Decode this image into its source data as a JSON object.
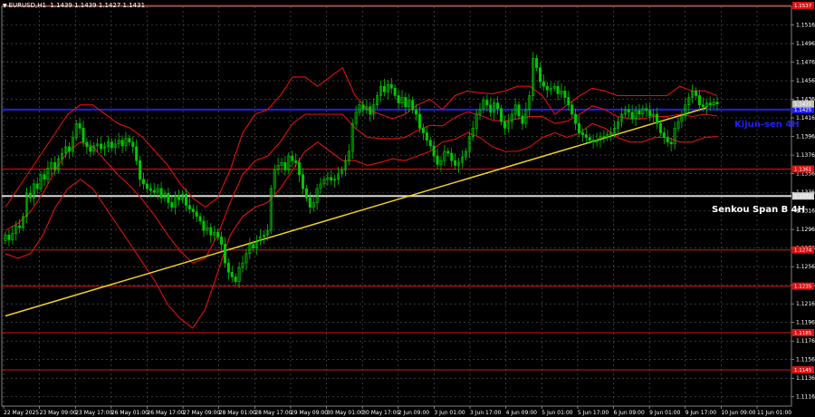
{
  "header": {
    "symbol": "EURUSD,H1",
    "ohlc": "1.1439 1.1439 1.1427 1.1431"
  },
  "colors": {
    "background": "#000000",
    "grid": "#5a5a5a",
    "candle": "#00c800",
    "bands": "#e01010",
    "trendline": "#f0d020",
    "kijun": "#1e1eff",
    "senkou": "#d8d8d8",
    "level": "#e01010"
  },
  "chart_data": {
    "type": "candlestick",
    "title": "",
    "ylim": [
      1.1106,
      1.1536
    ],
    "y_ticks": [
      "1.1516",
      "1.1496",
      "1.1476",
      "1.1456",
      "1.1436",
      "1.1416",
      "1.1396",
      "1.1376",
      "1.1356",
      "1.1336",
      "1.1316",
      "1.1296",
      "1.1276",
      "1.1256",
      "1.1236",
      "1.1216",
      "1.1196",
      "1.1176",
      "1.1156",
      "1.1136",
      "1.1116"
    ],
    "x_ticks": [
      "22 May 2025",
      "23 May 09:00",
      "23 May 17:00",
      "26 May 01:00",
      "26 May 17:00",
      "27 May 09:00",
      "28 May 01:00",
      "28 May 17:00",
      "29 May 09:00",
      "30 May 01:00",
      "30 May 17:00",
      "2 Jun 09:00",
      "3 Jun 01:00",
      "3 Jun 17:00",
      "4 Jun 09:00",
      "5 Jun 01:00",
      "5 Jun 17:00",
      "6 Jun 09:00",
      "9 Jun 01:00",
      "9 Jun 17:00",
      "10 Jun 09:00",
      "11 Jun 01:00"
    ],
    "current_price": "1.1431",
    "kijun": {
      "name": "Kijun-sen 4H",
      "value": 1.1425,
      "price_tag": "1.1425"
    },
    "senkou_b": {
      "name": "Senkou Span B 4H",
      "value": 1.1332,
      "price_tag": "1.1332"
    },
    "levels": [
      {
        "value": 1.1537,
        "tag": "1.1537"
      },
      {
        "value": 1.1361,
        "tag": "1.1361"
      },
      {
        "value": 1.1274,
        "tag": "1.1274"
      },
      {
        "value": 1.1235,
        "tag": "1.1235"
      },
      {
        "value": 1.1185,
        "tag": "1.1185"
      },
      {
        "value": 1.1145,
        "tag": "1.1145"
      }
    ],
    "trendline": {
      "from": [
        0,
        1.1203
      ],
      "to": [
        198,
        1.1427
      ]
    },
    "close": [
      1.129,
      1.1285,
      1.1292,
      1.13,
      1.1298,
      1.131,
      1.1335,
      1.133,
      1.1345,
      1.134,
      1.1355,
      1.135,
      1.1362,
      1.1368,
      1.136,
      1.1372,
      1.1378,
      1.1385,
      1.138,
      1.1395,
      1.141,
      1.1405,
      1.139,
      1.1385,
      1.138,
      1.1386,
      1.1388,
      1.1383,
      1.1385,
      1.139,
      1.1384,
      1.1388,
      1.1392,
      1.1386,
      1.1394,
      1.139,
      1.1385,
      1.137,
      1.135,
      1.1345,
      1.134,
      1.1338,
      1.1336,
      1.134,
      1.133,
      1.1335,
      1.1325,
      1.132,
      1.1332,
      1.1328,
      1.1334,
      1.1322,
      1.1318,
      1.1315,
      1.131,
      1.1305,
      1.1295,
      1.1298,
      1.129,
      1.1293,
      1.1288,
      1.128,
      1.126,
      1.125,
      1.1245,
      1.124,
      1.1255,
      1.126,
      1.127,
      1.128,
      1.1276,
      1.1284,
      1.1288,
      1.129,
      1.1295,
      1.134,
      1.136,
      1.1365,
      1.1368,
      1.136,
      1.1375,
      1.137,
      1.1368,
      1.1355,
      1.134,
      1.133,
      1.132,
      1.1325,
      1.134,
      1.1345,
      1.135,
      1.1352,
      1.1349,
      1.135,
      1.1356,
      1.136,
      1.137,
      1.138,
      1.141,
      1.1422,
      1.143,
      1.1425,
      1.1428,
      1.142,
      1.143,
      1.144,
      1.145,
      1.1444,
      1.1452,
      1.1448,
      1.144,
      1.1432,
      1.1438,
      1.1428,
      1.1435,
      1.1425,
      1.142,
      1.1405,
      1.14,
      1.1392,
      1.1386,
      1.1375,
      1.1366,
      1.137,
      1.138,
      1.1378,
      1.137,
      1.1365,
      1.1368,
      1.1374,
      1.138,
      1.1396,
      1.1405,
      1.142,
      1.1425,
      1.1435,
      1.143,
      1.1422,
      1.1432,
      1.1426,
      1.1412,
      1.1405,
      1.1412,
      1.142,
      1.143,
      1.1418,
      1.141,
      1.1425,
      1.144,
      1.148,
      1.147,
      1.1455,
      1.145,
      1.1446,
      1.1448,
      1.145,
      1.1442,
      1.1445,
      1.1438,
      1.143,
      1.142,
      1.141,
      1.14,
      1.1398,
      1.1395,
      1.1392,
      1.139,
      1.1392,
      1.1396,
      1.1395,
      1.1398,
      1.14,
      1.1405,
      1.1412,
      1.142,
      1.1425,
      1.1422,
      1.1415,
      1.1424,
      1.142,
      1.1426,
      1.1424,
      1.1418,
      1.142,
      1.141,
      1.14,
      1.1395,
      1.139,
      1.1388,
      1.1405,
      1.1412,
      1.1418,
      1.143,
      1.1438,
      1.1445,
      1.144,
      1.143,
      1.1428,
      1.1432,
      1.143,
      1.1433,
      1.1431
    ],
    "upper_band": [
      1.132,
      1.134,
      1.136,
      1.138,
      1.14,
      1.142,
      1.143,
      1.143,
      1.142,
      1.141,
      1.1405,
      1.1395,
      1.138,
      1.1365,
      1.1345,
      1.133,
      1.132,
      1.133,
      1.136,
      1.14,
      1.142,
      1.1425,
      1.144,
      1.146,
      1.146,
      1.145,
      1.146,
      1.147,
      1.144,
      1.1425,
      1.142,
      1.1415,
      1.142,
      1.143,
      1.1436,
      1.1425,
      1.144,
      1.1445,
      1.1443,
      1.1442,
      1.1445,
      1.145,
      1.145,
      1.144,
      1.142,
      1.143,
      1.144,
      1.1448,
      1.1445,
      1.144,
      1.144,
      1.144,
      1.144,
      1.144,
      1.145,
      1.1445,
      1.1445,
      1.144
    ],
    "lower_band": [
      1.127,
      1.1265,
      1.127,
      1.129,
      1.132,
      1.134,
      1.135,
      1.134,
      1.132,
      1.13,
      1.128,
      1.126,
      1.124,
      1.1215,
      1.12,
      1.119,
      1.121,
      1.125,
      1.129,
      1.131,
      1.132,
      1.1325,
      1.134,
      1.136,
      1.138,
      1.139,
      1.138,
      1.137,
      1.137,
      1.1365,
      1.1368,
      1.1372,
      1.137,
      1.1375,
      1.138,
      1.139,
      1.1393,
      1.14,
      1.1395,
      1.1385,
      1.138,
      1.138,
      1.1385,
      1.1395,
      1.14,
      1.1395,
      1.14,
      1.141,
      1.1405,
      1.1395,
      1.139,
      1.139,
      1.1395,
      1.1395,
      1.139,
      1.139,
      1.1395,
      1.1396
    ]
  }
}
